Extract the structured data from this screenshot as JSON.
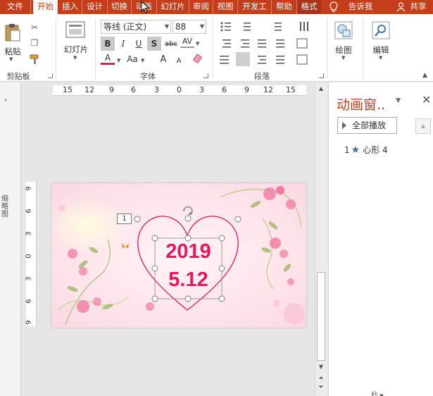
{
  "tabs": [
    {
      "label": "文件"
    },
    {
      "label": "开始"
    },
    {
      "label": "插入"
    },
    {
      "label": "设计"
    },
    {
      "label": "切换"
    },
    {
      "label": "动画"
    },
    {
      "label": "幻灯片"
    },
    {
      "label": "审阅"
    },
    {
      "label": "视图"
    },
    {
      "label": "开发工"
    },
    {
      "label": "帮助"
    },
    {
      "label": "格式"
    }
  ],
  "tellme": "告诉我",
  "share": "共享",
  "ribbon": {
    "clipboard": {
      "paste": "粘贴",
      "group": "剪贴板"
    },
    "slides": {
      "new_slide": "幻灯片"
    },
    "font": {
      "name": "等线 (正文)",
      "size": "88",
      "bold": "B",
      "italic": "I",
      "underline": "U",
      "shadow": "S",
      "strike": "abc",
      "spacing": "AV",
      "color": "A",
      "case": "Aa",
      "grow": "A",
      "shrink": "A",
      "group": "字体"
    },
    "paragraph": {
      "group": "段落"
    },
    "drawing": {
      "label": "绘图"
    },
    "editing": {
      "label": "编辑"
    }
  },
  "ruler": {
    "h": [
      "15",
      "12",
      "9",
      "6",
      "3",
      "0",
      "3",
      "6",
      "9",
      "12",
      "15"
    ],
    "v": [
      "9",
      "6",
      "3",
      "0",
      "3",
      "6",
      "9"
    ]
  },
  "slide": {
    "number": "1",
    "line1": "2019",
    "line2": "5.12"
  },
  "anim_pane": {
    "title": "动画窗..",
    "play_all": "全部播放",
    "items": [
      {
        "index": "1",
        "name": "心形 4"
      }
    ],
    "footer": "秒"
  },
  "side_label": "缩略图",
  "colors": {
    "accent": "#c43e1c",
    "date_text": "#e8175d"
  }
}
